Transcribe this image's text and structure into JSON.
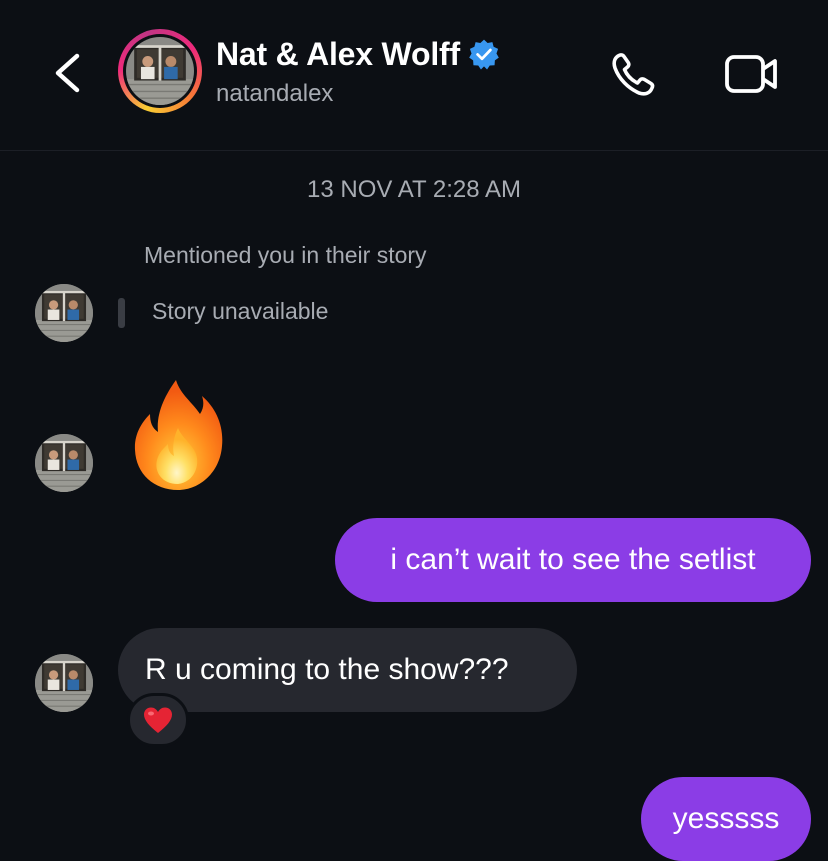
{
  "header": {
    "title": "Nat & Alex Wolff",
    "username": "natandalex",
    "verified": true,
    "icons": [
      "back-chevron-icon",
      "verified-badge-icon",
      "phone-icon",
      "video-camera-icon"
    ]
  },
  "thread": {
    "timestamp": "13 NOV AT 2:28 AM",
    "story_mention": {
      "label": "Mentioned you in their story",
      "status": "Story unavailable"
    },
    "messages": [
      {
        "direction": "incoming",
        "type": "emoji",
        "content": "fire-emoji"
      },
      {
        "direction": "outgoing",
        "type": "text",
        "text": "i can’t wait to see the setlist"
      },
      {
        "direction": "incoming",
        "type": "text",
        "text": "R u coming to the show???",
        "reaction": "red-heart-emoji"
      },
      {
        "direction": "outgoing",
        "type": "text",
        "text": "yesssss"
      }
    ]
  },
  "colors": {
    "background": "#0c0f14",
    "outgoing_bubble": "#8b3de6",
    "incoming_bubble": "#26282f",
    "secondary_text": "#a8acb3",
    "verified": "#3897f0"
  }
}
